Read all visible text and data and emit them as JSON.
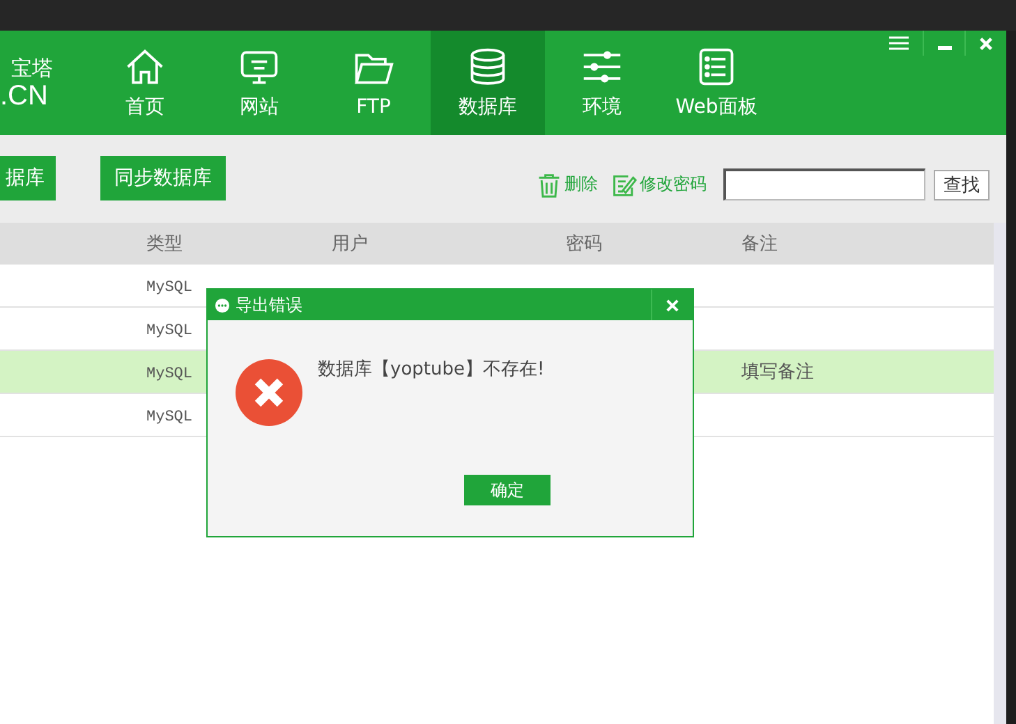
{
  "logo": {
    "line1": "宝塔",
    "line2": ".CN"
  },
  "nav": [
    {
      "label": "首页",
      "selected": false
    },
    {
      "label": "网站",
      "selected": false
    },
    {
      "label": "FTP",
      "selected": false
    },
    {
      "label": "数据库",
      "selected": true
    },
    {
      "label": "环境",
      "selected": false
    },
    {
      "label": "Web面板",
      "selected": false
    }
  ],
  "toolbar": {
    "buttons": [
      "据库",
      "同步数据库"
    ],
    "actions": [
      {
        "label": "删除"
      },
      {
        "label": "修改密码"
      }
    ],
    "search": {
      "button": "查找"
    }
  },
  "table": {
    "columns": [
      "类型",
      "用户",
      "密码",
      "备注"
    ],
    "rows": [
      {
        "type": "MySQL",
        "selected": false
      },
      {
        "type": "MySQL",
        "selected": false
      },
      {
        "type": "MySQL",
        "note": "填写备注",
        "selected": true
      },
      {
        "type": "MySQL",
        "selected": false
      }
    ]
  },
  "dialog": {
    "title": "导出错误",
    "message": "数据库【yoptube】不存在!",
    "button": "确定"
  }
}
